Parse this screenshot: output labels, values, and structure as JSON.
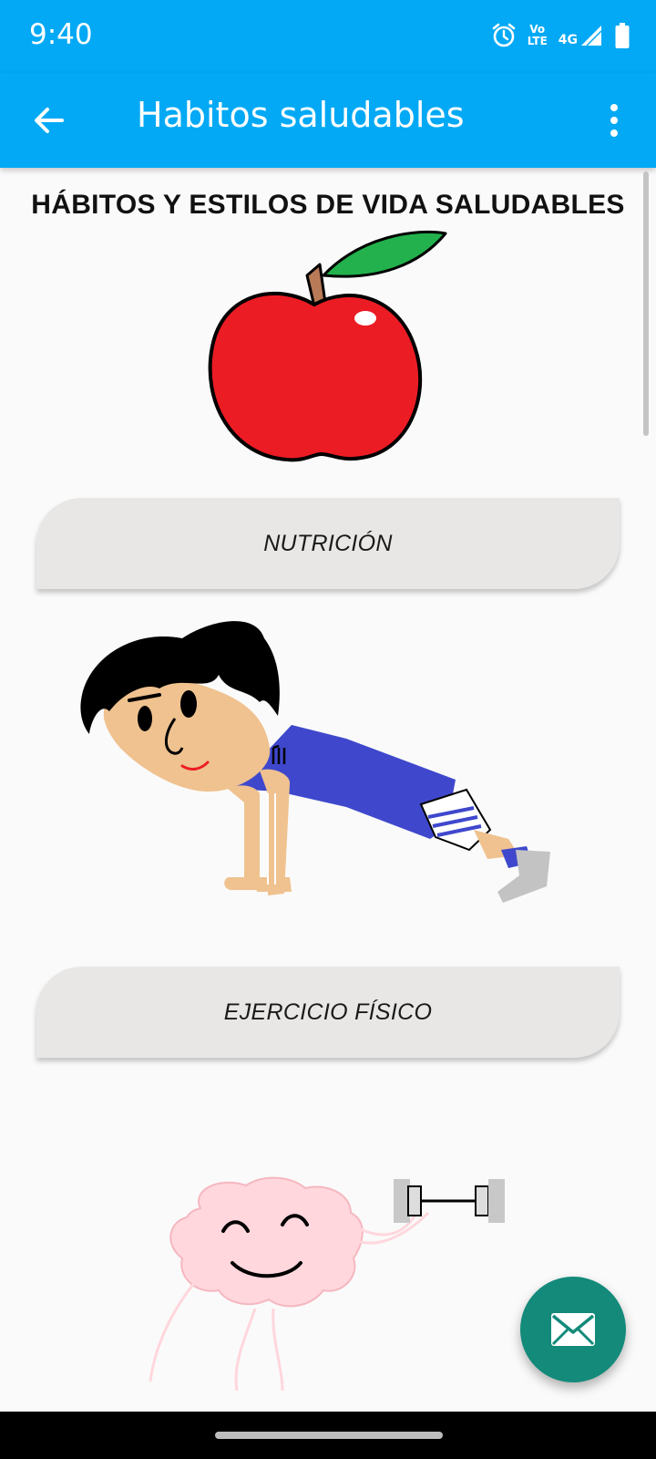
{
  "status_bar": {
    "time": "9:40",
    "volte_top": "Vo",
    "volte_bottom": "LTE",
    "network": "4G",
    "icons": [
      "alarm-icon",
      "volte-icon",
      "signal-icon",
      "battery-icon"
    ]
  },
  "app_bar": {
    "title": "Habitos saludables",
    "back_icon": "arrow-back-icon",
    "menu_icon": "more-vert-icon"
  },
  "main": {
    "heading": "HÁBITOS Y ESTILOS DE VIDA SALUDABLES",
    "sections": [
      {
        "label": "NUTRICIÓN",
        "image": "apple-illustration"
      },
      {
        "label": "EJERCICIO FÍSICO",
        "image": "pushup-boy-illustration"
      },
      {
        "image": "brain-dumbbell-illustration"
      }
    ]
  },
  "fab": {
    "icon": "mail-icon"
  },
  "colors": {
    "primary": "#03a9f4",
    "fab": "#138a7a",
    "button_bg": "#e8e7e6",
    "apple_red": "#ec1c24",
    "leaf_green": "#22b14c",
    "shirt_blue": "#3f48cc",
    "skin": "#efc28f",
    "brain_pink": "#ffd7dc"
  }
}
